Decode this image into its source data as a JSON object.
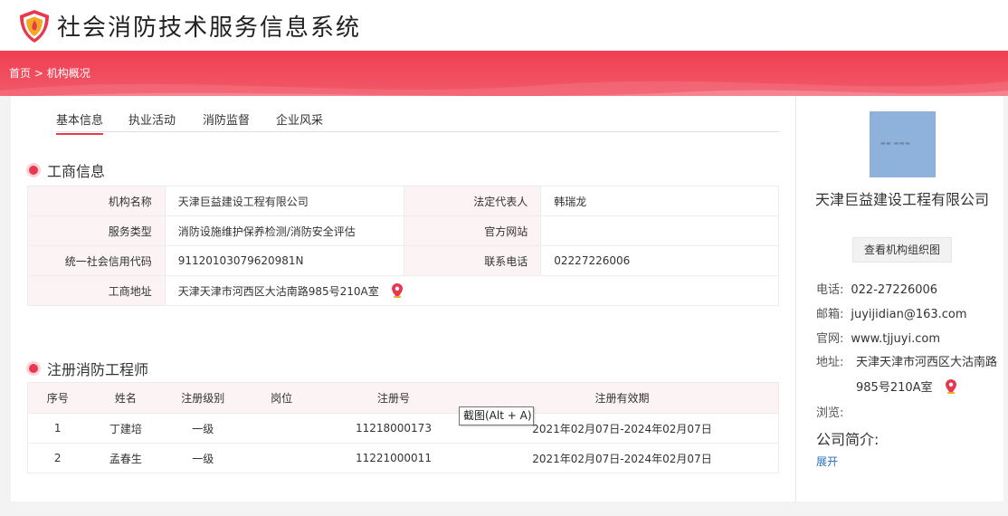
{
  "header": {
    "title": "社会消防技术服务信息系统"
  },
  "breadcrumb": {
    "home": "首页",
    "sep": " > ",
    "current": "机构概况"
  },
  "tabs": [
    {
      "label": "基本信息"
    },
    {
      "label": "执业活动"
    },
    {
      "label": "消防监督"
    },
    {
      "label": "企业风采"
    }
  ],
  "business": {
    "title": "工商信息",
    "rows": [
      {
        "l1": "机构名称",
        "v1": "天津巨益建设工程有限公司",
        "l2": "法定代表人",
        "v2": "韩瑞龙"
      },
      {
        "l1": "服务类型",
        "v1": "消防设施维护保养检测/消防安全评估",
        "l2": "官方网站",
        "v2": ""
      },
      {
        "l1": "统一社会信用代码",
        "v1": "91120103079620981N",
        "l2": "联系电话",
        "v2": "02227226006"
      },
      {
        "l1": "工商地址",
        "v1": "天津天津市河西区大沽南路985号210A室"
      }
    ]
  },
  "engineers": {
    "title": "注册消防工程师",
    "headers": [
      "序号",
      "姓名",
      "注册级别",
      "岗位",
      "注册号",
      "注册有效期"
    ],
    "rows": [
      [
        "1",
        "丁建培",
        "一级",
        "",
        "11218000173",
        "2021年02月07日-2024年02月07日"
      ],
      [
        "2",
        "孟春生",
        "一级",
        "",
        "11221000011",
        "2021年02月07日-2024年02月07日"
      ]
    ]
  },
  "tooltip": {
    "text": "截图(Alt + A)"
  },
  "sidebar": {
    "org_name": "天津巨益建设工程有限公司",
    "org_chart_button": "查看机构组织图",
    "phone_label": "电话:",
    "phone": "022-27226006",
    "email_label": "邮箱:",
    "email": "juyijidian@163.com",
    "site_label": "官网:",
    "site": "www.tjjuyi.com",
    "address_label": "地址:",
    "address": "天津天津市河西区大沽南路985号210A室",
    "views_label": "浏览:",
    "intro_label": "公司简介:",
    "expand_label": "展开"
  },
  "colors": {
    "accent": "#e8384f",
    "banner": "#ef3e52",
    "link": "#2a6ebd"
  }
}
